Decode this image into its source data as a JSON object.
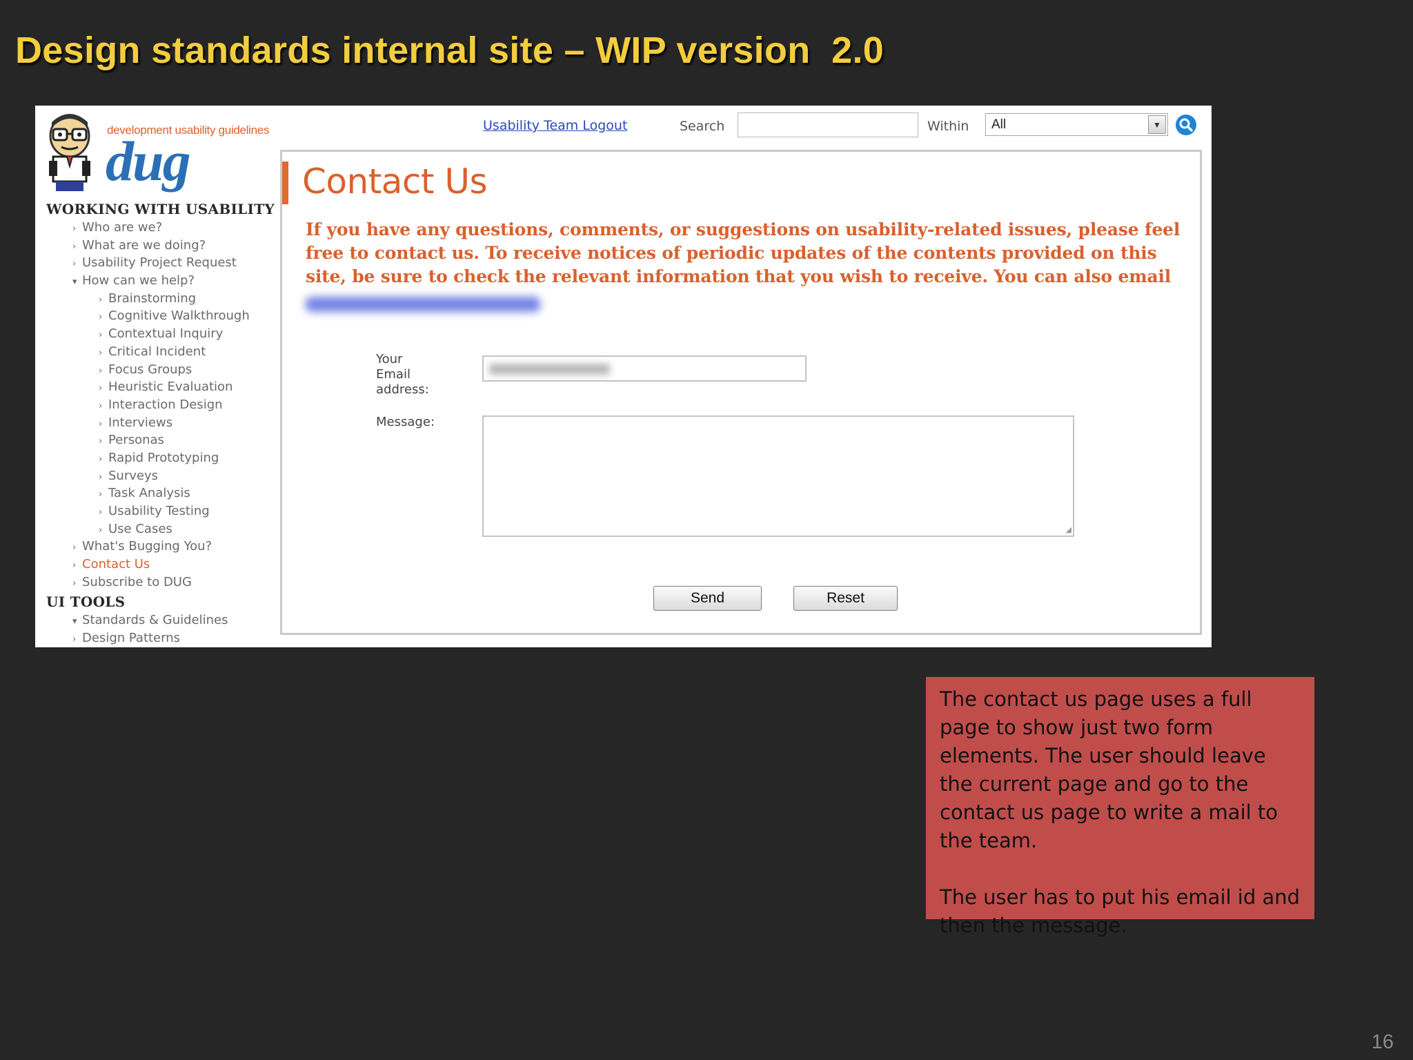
{
  "slide": {
    "title": "Design standards internal site – WIP version  2.0",
    "page_number": "16"
  },
  "logo": {
    "tagline": "development usability guidelines",
    "wordmark": "dug"
  },
  "sidebar": {
    "sections": [
      {
        "heading": "WORKING WITH USABILITY",
        "items": [
          {
            "label": "Who are we?",
            "level": 1,
            "bullet": "›"
          },
          {
            "label": "What are we doing?",
            "level": 1,
            "bullet": "›"
          },
          {
            "label": "Usability Project Request",
            "level": 1,
            "bullet": "›"
          },
          {
            "label": "How can we help?",
            "level": 1,
            "bullet": "▾"
          },
          {
            "label": "Brainstorming",
            "level": 2,
            "bullet": "›"
          },
          {
            "label": "Cognitive Walkthrough",
            "level": 2,
            "bullet": "›"
          },
          {
            "label": "Contextual Inquiry",
            "level": 2,
            "bullet": "›"
          },
          {
            "label": "Critical Incident",
            "level": 2,
            "bullet": "›"
          },
          {
            "label": "Focus Groups",
            "level": 2,
            "bullet": "›"
          },
          {
            "label": "Heuristic Evaluation",
            "level": 2,
            "bullet": "›"
          },
          {
            "label": "Interaction Design",
            "level": 2,
            "bullet": "›"
          },
          {
            "label": "Interviews",
            "level": 2,
            "bullet": "›"
          },
          {
            "label": "Personas",
            "level": 2,
            "bullet": "›"
          },
          {
            "label": "Rapid Prototyping",
            "level": 2,
            "bullet": "›"
          },
          {
            "label": "Surveys",
            "level": 2,
            "bullet": "›"
          },
          {
            "label": "Task Analysis",
            "level": 2,
            "bullet": "›"
          },
          {
            "label": "Usability Testing",
            "level": 2,
            "bullet": "›"
          },
          {
            "label": "Use Cases",
            "level": 2,
            "bullet": "›"
          },
          {
            "label": "What's Bugging You?",
            "level": 1,
            "bullet": "›"
          },
          {
            "label": "Contact Us",
            "level": 1,
            "bullet": "›",
            "active": true
          },
          {
            "label": "Subscribe to DUG",
            "level": 1,
            "bullet": "›"
          }
        ]
      },
      {
        "heading": "UI TOOLS",
        "items": [
          {
            "label": "Standards & Guidelines",
            "level": 1,
            "bullet": "▾"
          },
          {
            "label": "Design Patterns",
            "level": 1,
            "bullet": "›"
          }
        ]
      }
    ]
  },
  "topbar": {
    "logout_label": "Usability Team Logout",
    "search_label": "Search",
    "search_value": "",
    "within_label": "Within",
    "within_selected": "All"
  },
  "content": {
    "heading": "Contact Us",
    "intro": "If you have any questions, comments, or suggestions on usability-related issues, please feel free to contact us. To receive notices of periodic updates of the contents provided on this site, be sure to check the relevant information that you wish to receive. You can also email",
    "email_label_lines": [
      "Your",
      "Email",
      "address:"
    ],
    "message_label": "Message:",
    "send_label": "Send",
    "reset_label": "Reset"
  },
  "note": {
    "paragraph1": "The contact us page uses a full page to show just two form elements. The user should leave the current page and go to the contact us page to write a mail to the team.",
    "paragraph2": "The user has to put his email id and then the message."
  },
  "colors": {
    "title_yellow": "#f2cd3e",
    "accent_orange": "#d9612d",
    "link_blue": "#2a49b5",
    "note_red": "#c14d4b",
    "background": "#272627"
  }
}
